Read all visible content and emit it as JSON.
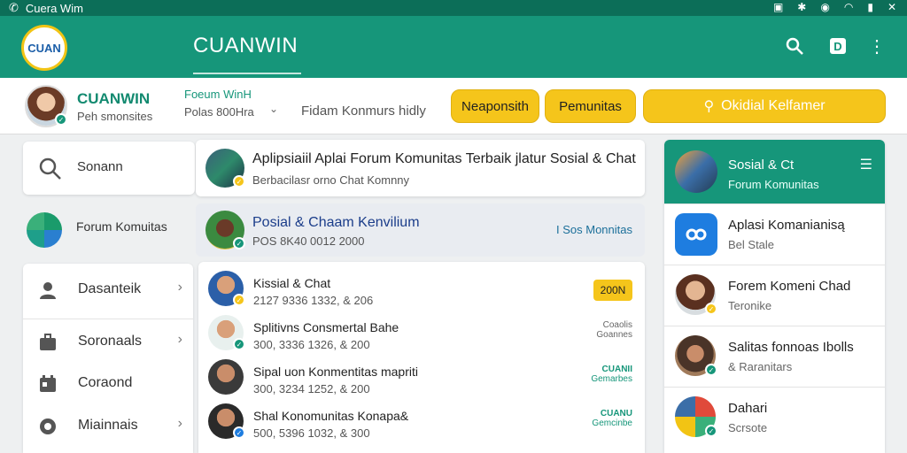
{
  "status_bar": {
    "title": "Cuera Wim",
    "icons": [
      "phone-icon",
      "sim-icon",
      "bluetooth-icon",
      "wifi-icon",
      "signal-icon",
      "close-icon"
    ]
  },
  "app_bar": {
    "logo_text": "CUAN",
    "title": "CUANWIN",
    "actions": [
      "search-icon",
      "chat-icon",
      "more-vert-icon"
    ]
  },
  "profile": {
    "name": "CUANWIN",
    "subtitle": "Peh smonsites"
  },
  "forum_select": {
    "name": "Foeum WinH",
    "subtitle": "Polas 800Hra"
  },
  "search_hint": "Fidam Konmurs hidly",
  "pills": {
    "p1": "Neaponsith",
    "p2": "Pemunitas",
    "p3": "Okidial Kelfamer"
  },
  "sidebar": {
    "search_label": "Sonann",
    "forum_label": "Forum Komuitas",
    "menu": [
      {
        "label": "Dasanteik"
      },
      {
        "label": "Soronaals"
      },
      {
        "label": "Coraond"
      },
      {
        "label": "Miainnais"
      }
    ]
  },
  "feed": {
    "post1": {
      "title": "Aplipsiaiil Aplai Forum Komunitas Terbaik jlatur Sosial & Chat",
      "subtitle": "Berbacilasr orno Chat Komnny"
    },
    "post2": {
      "title": "Posial & Chaam Kenvilium",
      "subtitle": "POS 8K40 0012 2000",
      "right": "I Sos Monnitas"
    },
    "chats": [
      {
        "title": "Kissial & Chat",
        "subtitle": "2127 9336 1332, & 206",
        "tag": "200N"
      },
      {
        "title": "Splitivns Consmertal Bahe",
        "subtitle": "300, 3336 1326, & 200",
        "right1": "Coaolis",
        "right2": "Goannes"
      },
      {
        "title": "Sipal uon Konmentitas mapriti",
        "subtitle": "300, 3234 1252, & 200",
        "right1": "CUANII",
        "right2": "Gemarbes"
      },
      {
        "title": "Shal Konomunitas Konapa&",
        "subtitle": "500, 5396 1032, & 300",
        "right1": "CUANU",
        "right2": "Gemcinbe"
      }
    ]
  },
  "right_panel": {
    "header": {
      "title": "Sosial & Ct",
      "subtitle": "Forum Komunitas"
    },
    "items": [
      {
        "title": "Aplasi Komanianisą",
        "subtitle": "Bel Stale"
      },
      {
        "title": "Forem Komeni Chad",
        "subtitle": "Teronike"
      },
      {
        "title": "Salitas fonnoas Ibolls",
        "subtitle": "& Raranitars"
      },
      {
        "title": "Dahari",
        "subtitle": "Scrsote"
      }
    ]
  },
  "colors": {
    "primary": "#16967a",
    "dark": "#0c6e58",
    "accent": "#f5c51b",
    "link": "#1b3d8a"
  }
}
